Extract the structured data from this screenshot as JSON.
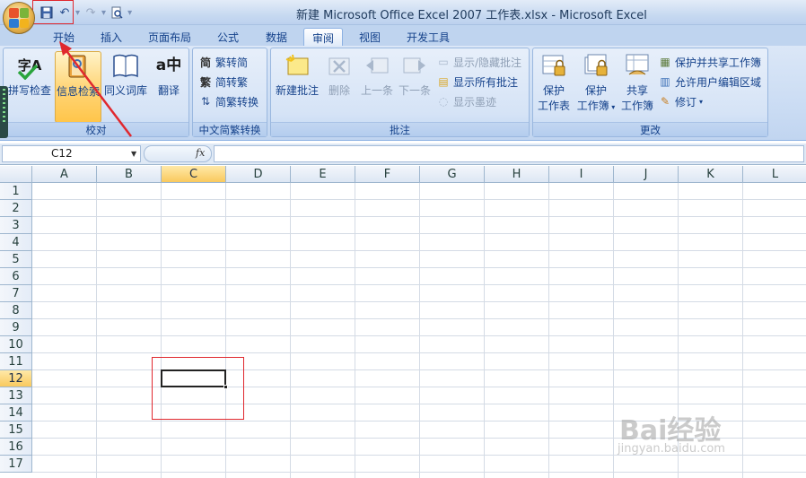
{
  "window": {
    "title": "新建 Microsoft Office Excel 2007 工作表.xlsx - Microsoft Excel"
  },
  "tabs": [
    "开始",
    "插入",
    "页面布局",
    "公式",
    "数据",
    "审阅",
    "视图",
    "开发工具"
  ],
  "active_tab": "审阅",
  "ribbon": {
    "proofing": {
      "label": "校对",
      "spelling": "拼写检查",
      "research": "信息检索",
      "thesaurus": "同义词库",
      "translate": "翻译",
      "spelling_icon_text": "字A",
      "translate_icon_text": "a中"
    },
    "chinese": {
      "label": "中文简繁转换",
      "to_simplified": "繁转简",
      "to_traditional": "简转繁",
      "convert": "简繁转换",
      "icon_simplified": "简",
      "icon_traditional": "繁"
    },
    "comments": {
      "label": "批注",
      "new": "新建批注",
      "delete": "删除",
      "previous": "上一条",
      "next": "下一条",
      "show_hide": "显示/隐藏批注",
      "show_all": "显示所有批注",
      "show_ink": "显示墨迹"
    },
    "changes": {
      "label": "更改",
      "protect_sheet_1": "保护",
      "protect_sheet_2": "工作表",
      "protect_workbook_1": "保护",
      "protect_workbook_2": "工作簿",
      "share_workbook_1": "共享",
      "share_workbook_2": "工作簿",
      "protect_share": "保护并共享工作簿",
      "allow_edit": "允许用户编辑区域",
      "track_changes": "修订"
    }
  },
  "formula_bar": {
    "name_box": "C12",
    "fx": "fx",
    "value": ""
  },
  "grid": {
    "columns": [
      "A",
      "B",
      "C",
      "D",
      "E",
      "F",
      "G",
      "H",
      "I",
      "J",
      "K",
      "L"
    ],
    "rows": [
      "1",
      "2",
      "3",
      "4",
      "5",
      "6",
      "7",
      "8",
      "9",
      "10",
      "11",
      "12",
      "13",
      "14",
      "15",
      "16",
      "17"
    ],
    "selected_column": "C",
    "selected_row": "12"
  },
  "watermark": {
    "brand": "Bai经验",
    "url": "jingyan.baidu.com"
  },
  "colors": {
    "annotation_red": "#e0282e",
    "ribbon_blue": "#15428b",
    "selected_header": "#f9c95e"
  }
}
